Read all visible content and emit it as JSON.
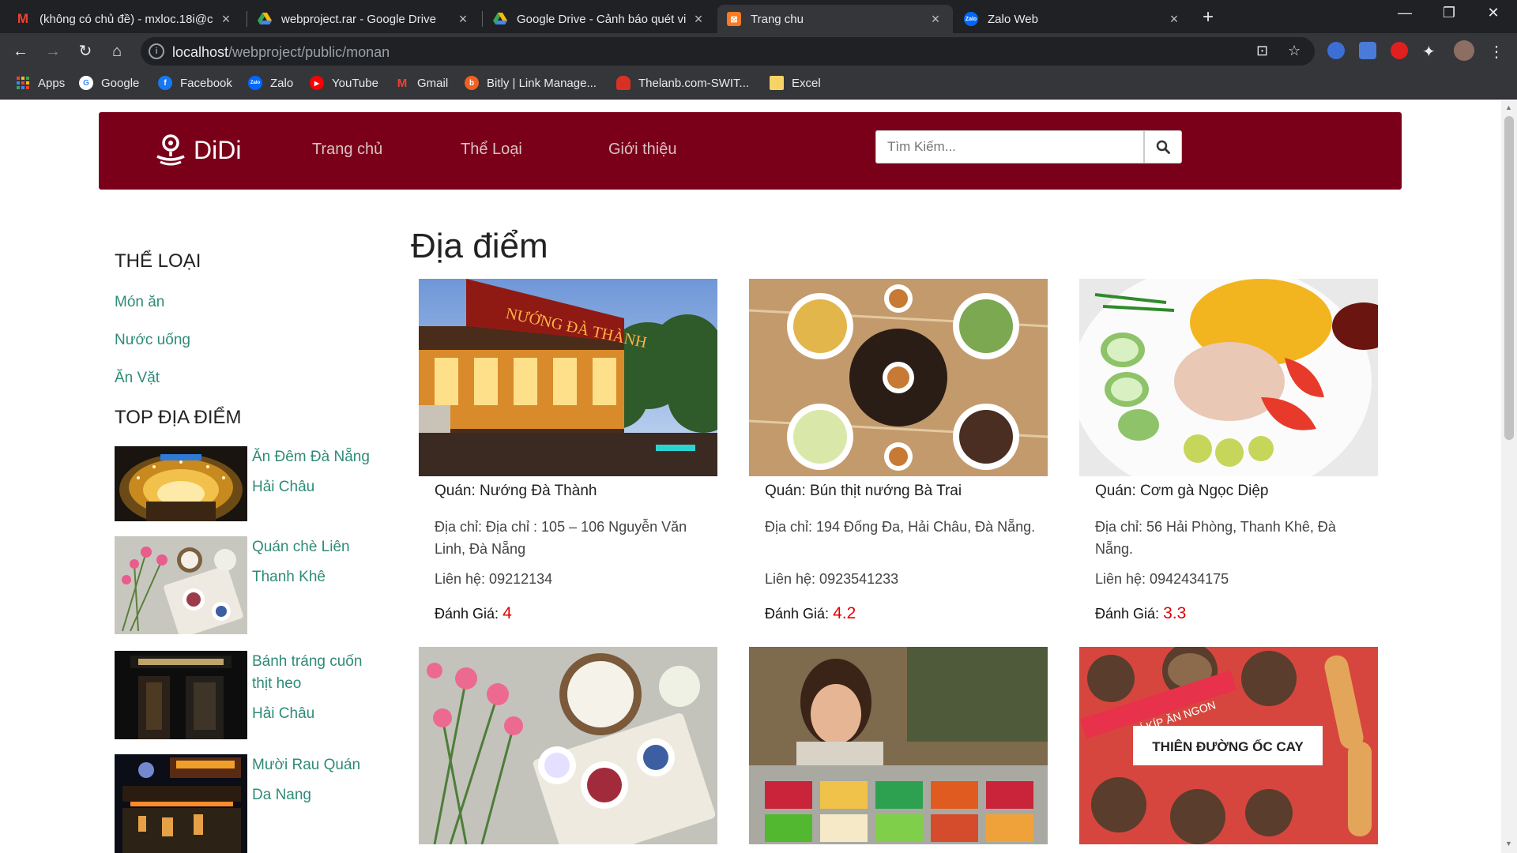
{
  "browser": {
    "tabs": [
      {
        "title": "(không có chủ đề) - mxloc.18i@c",
        "icon": "gmail-icon",
        "active": false
      },
      {
        "title": "webproject.rar - Google Drive",
        "icon": "google-drive-icon",
        "active": false
      },
      {
        "title": "Google Drive - Cảnh báo quét vi",
        "icon": "google-drive-icon",
        "active": false
      },
      {
        "title": "Trang chu",
        "icon": "xampp-icon",
        "active": true
      },
      {
        "title": "Zalo Web",
        "icon": "zalo-icon",
        "active": false
      }
    ],
    "url_host": "localhost",
    "url_path": "/webproject/public/monan",
    "bookmarks": [
      {
        "label": "Apps",
        "icon": "apps-grid-icon"
      },
      {
        "label": "Google",
        "icon": "google-icon"
      },
      {
        "label": "Facebook",
        "icon": "facebook-icon"
      },
      {
        "label": "Zalo",
        "icon": "zalo-icon"
      },
      {
        "label": "YouTube",
        "icon": "youtube-icon"
      },
      {
        "label": "Gmail",
        "icon": "gmail-icon"
      },
      {
        "label": "Bitly | Link Manage...",
        "icon": "bitly-icon"
      },
      {
        "label": "Thelanb.com-SWIT...",
        "icon": "cloud-icon"
      },
      {
        "label": "Excel",
        "icon": "folder-icon"
      }
    ]
  },
  "site": {
    "brand": "DiDi",
    "brand_color": "#7a0019",
    "nav": [
      "Trang chủ",
      "Thể Loại",
      "Giới thiệu"
    ],
    "search_placeholder": "Tìm Kiếm..."
  },
  "sidebar": {
    "categories_heading": "THỂ LOẠI",
    "categories": [
      "Món ăn",
      "Nước uống",
      "Ăn Vặt"
    ],
    "top_heading": "TOP ĐỊA ĐIỂM",
    "top_places": [
      {
        "name": "Ăn Đêm Đà Nẵng",
        "area": "Hải Châu"
      },
      {
        "name": "Quán chè Liên",
        "area": "Thanh Khê"
      },
      {
        "name": "Bánh tráng cuốn thịt heo",
        "area": "Hải Châu"
      },
      {
        "name": "Mười Rau Quán",
        "area": "Da Nang"
      }
    ]
  },
  "main": {
    "title": "Địa điểm",
    "labels": {
      "address": "Địa chỉ:",
      "contact": "Liên hệ:",
      "rating": "Đánh Giá:"
    },
    "cards": [
      {
        "name": "Quán: Nướng Đà Thành",
        "address": "Địa chỉ: Địa chỉ : 105 – 106 Nguyễn Văn Linh, Đà Nẵng",
        "contact": "Liên hệ: 09212134",
        "rating_label": "Đánh Giá:",
        "rating": "4"
      },
      {
        "name": "Quán: Bún thịt nướng Bà Trai",
        "address": "Địa chỉ: 194 Đống Đa, Hải Châu, Đà Nẵng.",
        "contact": "Liên hệ: 0923541233",
        "rating_label": "Đánh Giá:",
        "rating": "4.2"
      },
      {
        "name": "Quán: Cơm gà Ngọc Diệp",
        "address": "Địa chỉ: 56 Hải Phòng, Thanh Khê, Đà Nẵng.",
        "contact": "Liên hệ: 0942434175",
        "rating_label": "Đánh Giá:",
        "rating": "3.3"
      }
    ],
    "second_row_banner": {
      "ribbon": "BÍ KÍP ĂN NGON",
      "title": "THIÊN ĐƯỜNG ỐC CAY"
    },
    "restaurant_sign": "NƯỚNG ĐÀ THÀNH"
  }
}
